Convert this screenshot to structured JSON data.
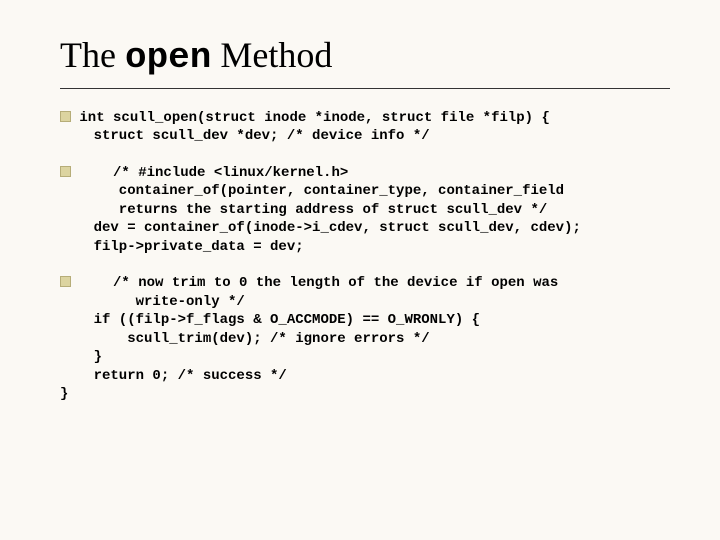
{
  "title": {
    "pre": "The ",
    "mono": "open",
    "post": " Method"
  },
  "code": {
    "b1l1": "int scull_open(struct inode *inode, struct file *filp) {",
    "b1l2": "    struct scull_dev *dev; /* device info */",
    "b2l1": "    /* #include <linux/kernel.h>",
    "b2l2": "       container_of(pointer, container_type, container_field",
    "b2l3": "       returns the starting address of struct scull_dev */",
    "b2l4": "    dev = container_of(inode->i_cdev, struct scull_dev, cdev);",
    "b2l5": "    filp->private_data = dev;",
    "b3l1": "    /* now trim to 0 the length of the device if open was",
    "b3l2": "         write-only */",
    "b3l3": "    if ((filp->f_flags & O_ACCMODE) == O_WRONLY) {",
    "b3l4": "        scull_trim(dev); /* ignore errors */",
    "b3l5": "    }",
    "b3l6": "    return 0; /* success */",
    "b3l7": "}"
  }
}
